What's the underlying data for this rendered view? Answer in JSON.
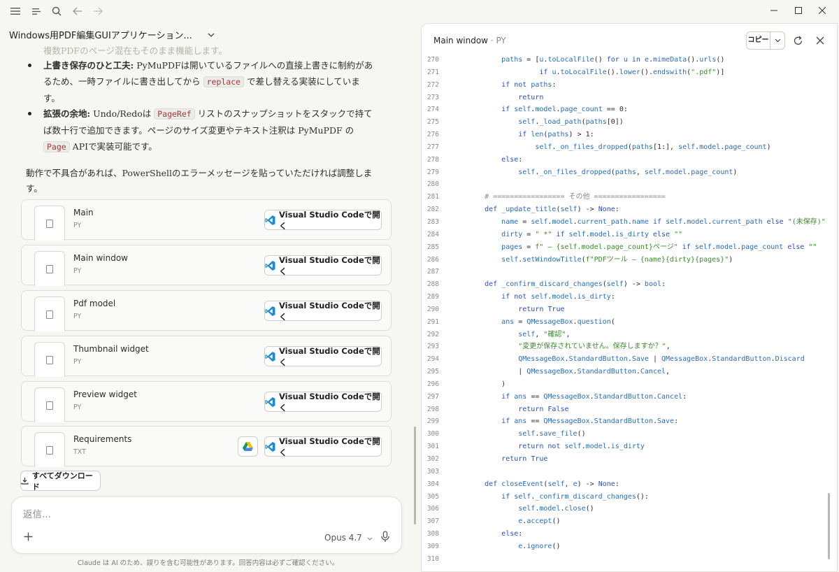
{
  "window": {
    "minimize": "—",
    "maximize": "☐",
    "close": "✕"
  },
  "conversation": {
    "title": "Windows用PDF編集GUIアプリケーション...",
    "faded_line": "複数PDFのページ混在もそのまま機能します。",
    "bullets": [
      {
        "head": "上書き保存のひと工夫:",
        "pre": " PyMuPDFは開いているファイルへの直接上書きに制約があるため、一時ファイルに書き出してから ",
        "code": "replace",
        "post": " で差し替える実装にしています。"
      },
      {
        "head": "拡張の余地:",
        "pre": " Undo/Redoは ",
        "code": "PageRef",
        "mid": " リストのスナップショットをスタックで持てば数十行で追加できます。ページのサイズ変更やテキスト注釈は PyMuPDF の ",
        "code2": "Page",
        "post": " APIで実装可能です。"
      }
    ],
    "closing": "動作で不具合があれば、PowerShellのエラーメッセージを貼っていただければ調整します。"
  },
  "files": [
    {
      "name": "Main",
      "ext": "PY",
      "open_label": "Visual Studio Codeで開く",
      "drive": false
    },
    {
      "name": "Main window",
      "ext": "PY",
      "open_label": "Visual Studio Codeで開く",
      "drive": false
    },
    {
      "name": "Pdf model",
      "ext": "PY",
      "open_label": "Visual Studio Codeで開く",
      "drive": false
    },
    {
      "name": "Thumbnail widget",
      "ext": "PY",
      "open_label": "Visual Studio Codeで開く",
      "drive": false
    },
    {
      "name": "Preview widget",
      "ext": "PY",
      "open_label": "Visual Studio Codeで開く",
      "drive": false
    },
    {
      "name": "Requirements",
      "ext": "TXT",
      "open_label": "Visual Studio Codeで開く",
      "drive": true
    }
  ],
  "download_all": "すべてダウンロード",
  "composer": {
    "placeholder": "返信...",
    "model": "Opus 4.7"
  },
  "disclaimer": "Claude は AI のため、誤りを含む可能性があります。回答内容は必ずご確認ください。",
  "artifact": {
    "title": "Main window",
    "subtitle": "· PY",
    "copy_label": "コピー",
    "code_lines": [
      {
        "n": "270",
        "t": "        paths = [u.toLocalFile() for u in e.mimeData().urls()"
      },
      {
        "n": "271",
        "t": "                 if u.toLocalFile().lower().endswith(\".pdf\")]"
      },
      {
        "n": "272",
        "t": "        if not paths:"
      },
      {
        "n": "273",
        "t": "            return"
      },
      {
        "n": "274",
        "t": "        if self.model.page_count == 0:"
      },
      {
        "n": "275",
        "t": "            self._load_path(paths[0])"
      },
      {
        "n": "276",
        "t": "            if len(paths) > 1:"
      },
      {
        "n": "277",
        "t": "                self._on_files_dropped(paths[1:], self.model.page_count)"
      },
      {
        "n": "278",
        "t": "        else:"
      },
      {
        "n": "279",
        "t": "            self._on_files_dropped(paths, self.model.page_count)"
      },
      {
        "n": "280",
        "t": ""
      },
      {
        "n": "281",
        "t": "    # ================= その他 ================="
      },
      {
        "n": "282",
        "t": "    def _update_title(self) -> None:"
      },
      {
        "n": "283",
        "t": "        name = self.model.current_path.name if self.model.current_path else \"(未保存)\""
      },
      {
        "n": "284",
        "t": "        dirty = \" *\" if self.model.is_dirty else \"\""
      },
      {
        "n": "285",
        "t": "        pages = f\" — {self.model.page_count}ページ\" if self.model.page_count else \"\""
      },
      {
        "n": "286",
        "t": "        self.setWindowTitle(f\"PDFツール — {name}{dirty}{pages}\")"
      },
      {
        "n": "287",
        "t": ""
      },
      {
        "n": "288",
        "t": "    def _confirm_discard_changes(self) -> bool:"
      },
      {
        "n": "289",
        "t": "        if not self.model.is_dirty:"
      },
      {
        "n": "290",
        "t": "            return True"
      },
      {
        "n": "291",
        "t": "        ans = QMessageBox.question("
      },
      {
        "n": "292",
        "t": "            self, \"確認\","
      },
      {
        "n": "293",
        "t": "            \"変更が保存されていません。保存しますか？\","
      },
      {
        "n": "294",
        "t": "            QMessageBox.StandardButton.Save | QMessageBox.StandardButton.Discard"
      },
      {
        "n": "295",
        "t": "            | QMessageBox.StandardButton.Cancel,"
      },
      {
        "n": "296",
        "t": "        )"
      },
      {
        "n": "297",
        "t": "        if ans == QMessageBox.StandardButton.Cancel:"
      },
      {
        "n": "298",
        "t": "            return False"
      },
      {
        "n": "299",
        "t": "        if ans == QMessageBox.StandardButton.Save:"
      },
      {
        "n": "300",
        "t": "            self.save_file()"
      },
      {
        "n": "301",
        "t": "            return not self.model.is_dirty"
      },
      {
        "n": "302",
        "t": "        return True"
      },
      {
        "n": "303",
        "t": ""
      },
      {
        "n": "304",
        "t": "    def closeEvent(self, e) -> None:"
      },
      {
        "n": "305",
        "t": "        if self._confirm_discard_changes():"
      },
      {
        "n": "306",
        "t": "            self.model.close()"
      },
      {
        "n": "307",
        "t": "            e.accept()"
      },
      {
        "n": "308",
        "t": "        else:"
      },
      {
        "n": "309",
        "t": "            e.ignore()"
      },
      {
        "n": "310",
        "t": ""
      }
    ]
  }
}
